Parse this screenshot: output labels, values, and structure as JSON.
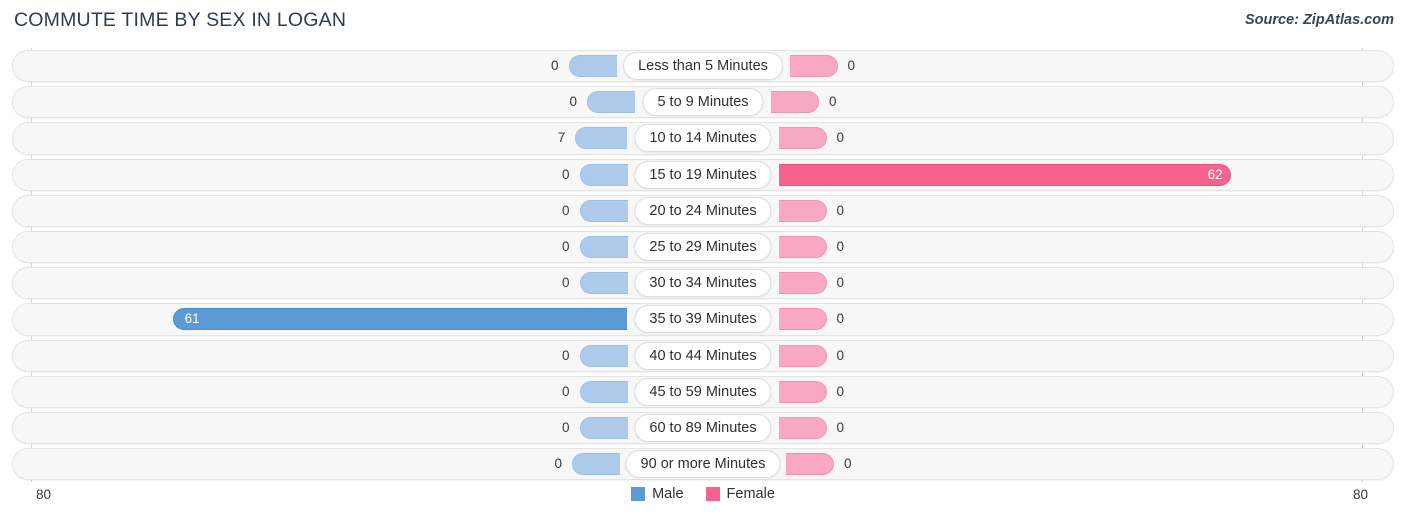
{
  "header": {
    "title": "COMMUTE TIME BY SEX IN LOGAN",
    "source": "Source: ZipAtlas.com"
  },
  "axis": {
    "left_tick": "80",
    "right_tick": "80"
  },
  "legend": {
    "items": [
      {
        "label": "Male",
        "color": "#5b9bd5"
      },
      {
        "label": "Female",
        "color": "#f4628f"
      }
    ]
  },
  "colors": {
    "male_light": "#aecbec",
    "male_strong": "#5b9bd5",
    "female_light": "#f9a8c3",
    "female_strong": "#f4628f",
    "track": "#f7f7f7",
    "title": "#2f3c4f"
  },
  "chart_data": {
    "type": "bar",
    "title": "COMMUTE TIME BY SEX IN LOGAN",
    "subtitle": "",
    "orientation": "horizontal-diverging",
    "xlabel": "",
    "ylabel": "",
    "xlim": [
      80,
      80
    ],
    "axis_max_left": 80,
    "axis_max_right": 80,
    "grid": false,
    "legend_position": "bottom-center",
    "categories": [
      "Less than 5 Minutes",
      "5 to 9 Minutes",
      "10 to 14 Minutes",
      "15 to 19 Minutes",
      "20 to 24 Minutes",
      "25 to 29 Minutes",
      "30 to 34 Minutes",
      "35 to 39 Minutes",
      "40 to 44 Minutes",
      "45 to 59 Minutes",
      "60 to 89 Minutes",
      "90 or more Minutes"
    ],
    "series": [
      {
        "name": "Male",
        "color": "#5b9bd5",
        "values": [
          0,
          0,
          7,
          0,
          0,
          0,
          0,
          61,
          0,
          0,
          0,
          0
        ]
      },
      {
        "name": "Female",
        "color": "#f4628f",
        "values": [
          0,
          0,
          0,
          62,
          0,
          0,
          0,
          0,
          0,
          0,
          0,
          0
        ]
      }
    ],
    "rows": [
      {
        "label": "Less than 5 Minutes",
        "male": 0,
        "male_text": "0",
        "female": 0,
        "female_text": "0"
      },
      {
        "label": "5 to 9 Minutes",
        "male": 0,
        "male_text": "0",
        "female": 0,
        "female_text": "0"
      },
      {
        "label": "10 to 14 Minutes",
        "male": 7,
        "male_text": "7",
        "female": 0,
        "female_text": "0"
      },
      {
        "label": "15 to 19 Minutes",
        "male": 0,
        "male_text": "0",
        "female": 62,
        "female_text": "62"
      },
      {
        "label": "20 to 24 Minutes",
        "male": 0,
        "male_text": "0",
        "female": 0,
        "female_text": "0"
      },
      {
        "label": "25 to 29 Minutes",
        "male": 0,
        "male_text": "0",
        "female": 0,
        "female_text": "0"
      },
      {
        "label": "30 to 34 Minutes",
        "male": 0,
        "male_text": "0",
        "female": 0,
        "female_text": "0"
      },
      {
        "label": "35 to 39 Minutes",
        "male": 61,
        "male_text": "61",
        "female": 0,
        "female_text": "0"
      },
      {
        "label": "40 to 44 Minutes",
        "male": 0,
        "male_text": "0",
        "female": 0,
        "female_text": "0"
      },
      {
        "label": "45 to 59 Minutes",
        "male": 0,
        "male_text": "0",
        "female": 0,
        "female_text": "0"
      },
      {
        "label": "60 to 89 Minutes",
        "male": 0,
        "male_text": "0",
        "female": 0,
        "female_text": "0"
      },
      {
        "label": "90 or more Minutes",
        "male": 0,
        "male_text": "0",
        "female": 0,
        "female_text": "0"
      }
    ]
  }
}
